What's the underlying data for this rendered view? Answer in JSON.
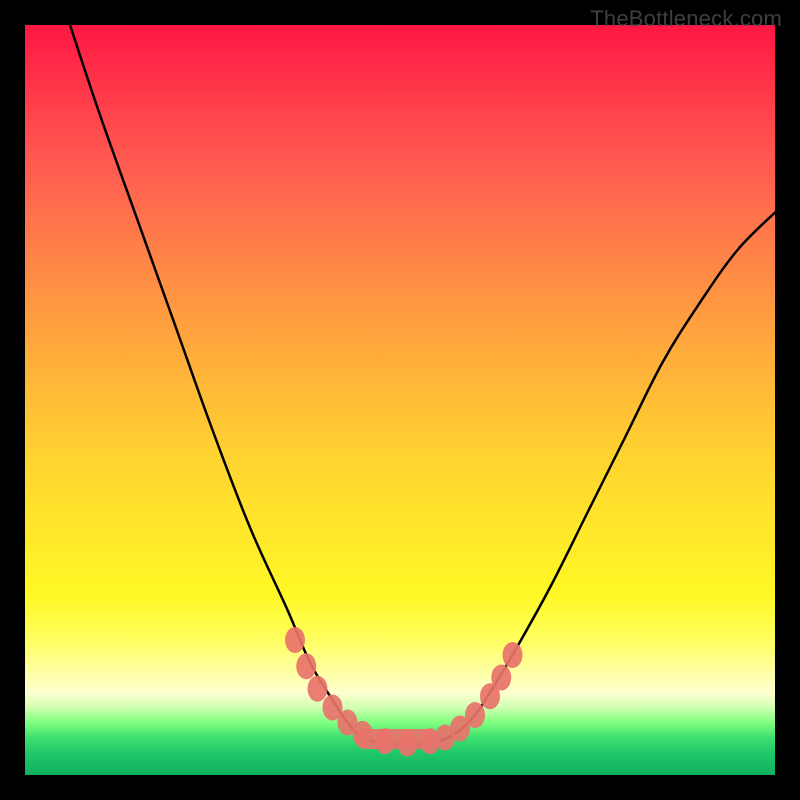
{
  "watermark": "TheBottleneck.com",
  "chart_data": {
    "type": "line",
    "title": "",
    "xlabel": "",
    "ylabel": "",
    "xlim": [
      0,
      100
    ],
    "ylim": [
      0,
      100
    ],
    "series": [
      {
        "name": "bottleneck-curve",
        "x": [
          6,
          10,
          15,
          20,
          25,
          30,
          35,
          38,
          41,
          43,
          45,
          48,
          51,
          54,
          56,
          58,
          60,
          62,
          65,
          70,
          75,
          80,
          85,
          90,
          95,
          100
        ],
        "values": [
          100,
          88,
          74,
          60,
          46,
          33,
          22,
          15,
          10,
          7,
          5,
          4.2,
          4,
          4.2,
          4.8,
          6,
          8,
          11,
          16,
          25,
          35,
          45,
          55,
          63,
          70,
          75
        ]
      },
      {
        "name": "highlight-points",
        "x": [
          36,
          37.5,
          39,
          41,
          43,
          45,
          48,
          51,
          54,
          56,
          58,
          60,
          62,
          63.5,
          65
        ],
        "values": [
          18,
          14.5,
          11.5,
          9,
          7,
          5.5,
          4.5,
          4.2,
          4.5,
          5,
          6.2,
          8,
          10.5,
          13,
          16
        ]
      }
    ],
    "gradient_stops": [
      {
        "pos": 0,
        "color": "#ff1744"
      },
      {
        "pos": 50,
        "color": "#ffd430"
      },
      {
        "pos": 80,
        "color": "#ffff60"
      },
      {
        "pos": 93,
        "color": "#80ff80"
      },
      {
        "pos": 100,
        "color": "#10b060"
      }
    ]
  }
}
